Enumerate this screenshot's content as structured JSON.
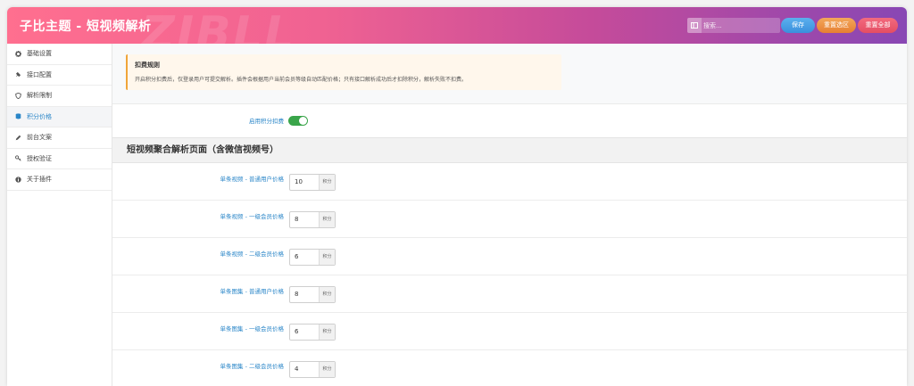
{
  "header": {
    "title": "子比主题 - 短视频解析",
    "watermark": "ZIBLL",
    "search_placeholder": "搜索...",
    "save_label": "保存",
    "reset_section_label": "重置选区",
    "reset_all_label": "重置全部"
  },
  "sidebar": {
    "items": [
      {
        "label": "基础设置",
        "icon": "gear-icon"
      },
      {
        "label": "接口配置",
        "icon": "plug-icon"
      },
      {
        "label": "解析限制",
        "icon": "shield-icon"
      },
      {
        "label": "积分价格",
        "icon": "database-icon",
        "active": true
      },
      {
        "label": "前台文案",
        "icon": "pencil-icon"
      },
      {
        "label": "授权验证",
        "icon": "key-icon"
      },
      {
        "label": "关于插件",
        "icon": "info-icon"
      }
    ]
  },
  "notice": {
    "title": "扣费规则",
    "text": "开启积分扣费后，仅登录用户可提交解析。插件会根据用户当前会员等级自动匹配价格；只有接口解析成功后才扣除积分，解析失败不扣费。"
  },
  "toggle": {
    "label": "启用积分扣费",
    "enabled": true
  },
  "section": {
    "title": "短视频聚合解析页面（含微信视频号）"
  },
  "unit": "积分",
  "fields": [
    {
      "label": "单条视频 - 普通用户价格",
      "value": "10"
    },
    {
      "label": "单条视频 - 一级会员价格",
      "value": "8"
    },
    {
      "label": "单条视频 - 二级会员价格",
      "value": "6"
    },
    {
      "label": "单条图集 - 普通用户价格",
      "value": "8"
    },
    {
      "label": "单条图集 - 一级会员价格",
      "value": "6"
    },
    {
      "label": "单条图集 - 二级会员价格",
      "value": "4"
    }
  ],
  "colors": {
    "accent_blue": "#2a86c8",
    "toggle_green": "#3aa54a",
    "notice_border": "#f0a53a"
  }
}
